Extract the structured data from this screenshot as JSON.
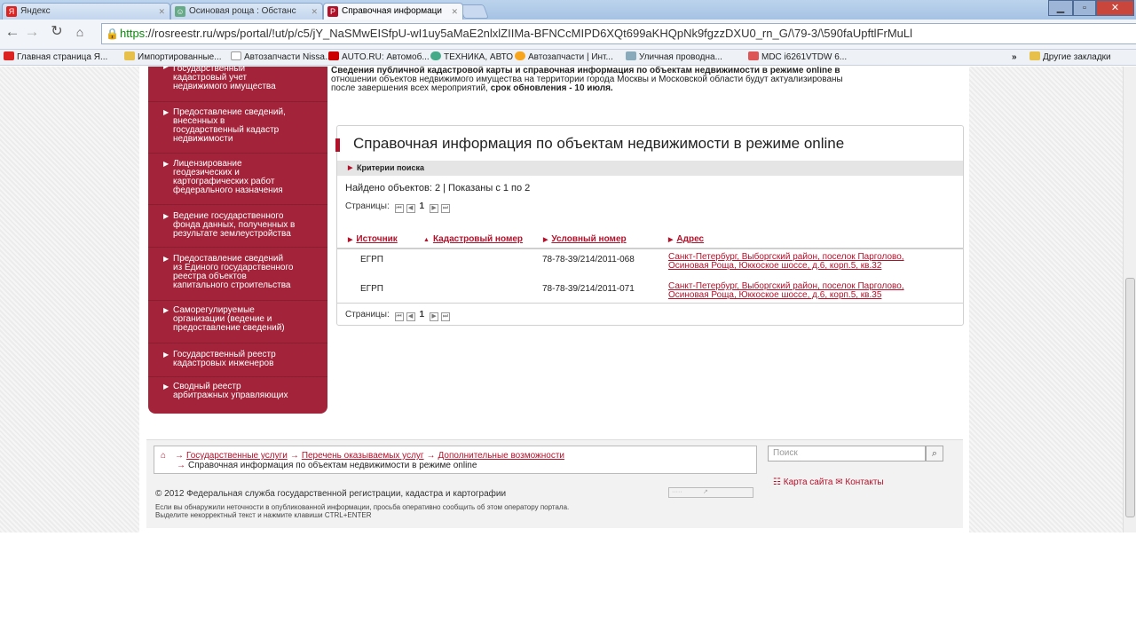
{
  "browser": {
    "tabs": [
      {
        "label": "Яндекс",
        "favicon": "Я"
      },
      {
        "label": "Осиновая роща : Обстанс",
        "favicon": "☺"
      },
      {
        "label": "Справочная информаци",
        "favicon": "Р"
      }
    ],
    "url_scheme": "https",
    "url_rest": "://rosreestr.ru/wps/portal/!ut/p/c5/jY_NaSMwEISfpU-wI1uy5aMaE2nlxlZIIMa-BFNCcMIPD6XQt699aKHQpNk9fgzzDXU0_rn_G/\\79-3/\\590faUpftlFrMuLl",
    "bookmarks": [
      {
        "label": "Главная страница Я...",
        "icon": "yandex-icon"
      },
      {
        "label": "Импортированные...",
        "icon": "folder-icon"
      },
      {
        "label": "Автозапчасти Nissa...",
        "icon": "page-icon"
      },
      {
        "label": "AUTO.RU: Автомоб...",
        "icon": "auto-icon"
      },
      {
        "label": "ТЕХНИКА, АВТО",
        "icon": "globe-icon"
      },
      {
        "label": "Автозапчасти | Инт...",
        "icon": "star-icon"
      },
      {
        "label": "Уличная проводна...",
        "icon": "wire-icon"
      },
      {
        "label": "MDC i6261VTDW 6...",
        "icon": "mdc-icon"
      }
    ],
    "overflow": "»",
    "other_bookmarks": "Другие закладки"
  },
  "sidebar": {
    "items": [
      {
        "lines": [
          "Государственный",
          "кадастровый учет",
          "недвижимого имущества"
        ]
      },
      {
        "lines": [
          "Предоставление сведений,",
          "внесенных в",
          "государственный кадастр",
          "недвижимости"
        ]
      },
      {
        "lines": [
          "Лицензирование",
          "геодезических и",
          "картографических работ",
          "федерального назначения"
        ]
      },
      {
        "lines": [
          "Ведение государственного",
          "фонда данных, полученных в",
          "результате землеустройства"
        ]
      },
      {
        "lines": [
          "Предоставление сведений",
          "из Единого государственного",
          "реестра объектов",
          "капитального строительства"
        ]
      },
      {
        "lines": [
          "Саморегулируемые",
          "организации (ведение и",
          "предоставление сведений)"
        ]
      },
      {
        "lines": [
          "Государственный реестр",
          "кадастровых инженеров"
        ]
      },
      {
        "lines": [
          "Сводный реестр",
          "арбитражных управляющих"
        ]
      }
    ]
  },
  "notice": {
    "line1": "Сведения публичной кадастровой карты и справочная информация по объектам недвижимости в режиме online в",
    "line2": "отношении объектов недвижимого имущества на территории города Москвы и Московской области будут актуализированы",
    "line3_pre": "после завершения всех мероприятий, ",
    "line3_bold": "срок обновления - 10 июля."
  },
  "panel": {
    "title": "Справочная информация по объектам недвижимости в режиме online",
    "criteria": "Критерии поиска",
    "found": "Найдено объектов: 2 | Показаны с 1 по 2",
    "pages_label": "Страницы:",
    "pages_label2": "Страницы:",
    "current_page": "1",
    "columns": [
      "Источник",
      "Кадастровый номер",
      "Условный номер",
      "Адрес"
    ],
    "rows": [
      {
        "source": "ЕГРП",
        "cadastral": "",
        "conditional": "78-78-39/214/2011-068",
        "address1": "Санкт-Петербург, Выборгский район, поселок Парголово,",
        "address2": "Осиновая Роща, Юккоское шоссе, д.6, корп.5, кв.32"
      },
      {
        "source": "ЕГРП",
        "cadastral": "",
        "conditional": "78-78-39/214/2011-071",
        "address1": "Санкт-Петербург, Выборгский район, поселок Парголово,",
        "address2": "Осиновая Роща, Юккоское шоссе, д.6, корп.5, кв.35"
      }
    ]
  },
  "footer": {
    "crumbs": [
      "Государственные услуги",
      "Перечень оказываемых услуг",
      "Дополнительные возможности"
    ],
    "current": "Справочная информация по объектам недвижимости в режиме online",
    "search_placeholder": "Поиск",
    "sitemap": "Карта сайта",
    "contacts": "Контакты",
    "copyright": "© 2012 Федеральная служба государственной регистрации, кадастра и картографии",
    "help1": "Если вы обнаружили неточности в опубликованной информации, просьба оперативно сообщить об этом оператору портала.",
    "help2": "Выделите некорректный текст и нажмите клавиши CTRL+ENTER"
  }
}
